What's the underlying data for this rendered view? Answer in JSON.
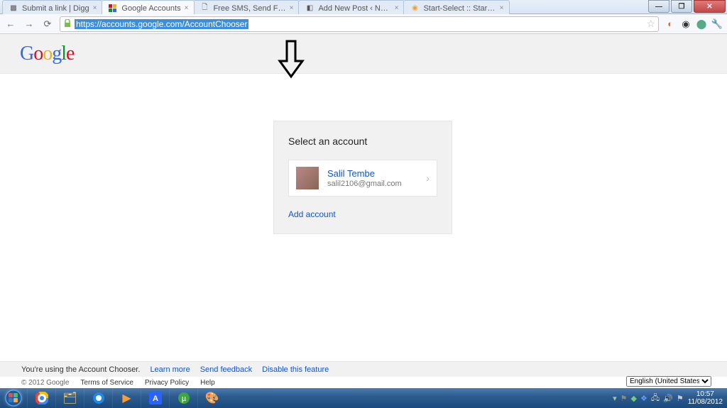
{
  "window": {
    "tabs": [
      {
        "title": "Submit a link | Digg",
        "active": false
      },
      {
        "title": "Google Accounts",
        "active": true
      },
      {
        "title": "Free SMS, Send Free SMS, S",
        "active": false
      },
      {
        "title": "Add New Post ‹ Nuclearrar",
        "active": false
      },
      {
        "title": "Start-Select :: Start/Select",
        "active": false
      }
    ],
    "url": "https://accounts.google.com/AccountChooser"
  },
  "page": {
    "logo": "Google",
    "card_title": "Select an account",
    "account": {
      "name": "Salil Tembe",
      "email": "salil2106@gmail.com"
    },
    "add_account": "Add account"
  },
  "footer": {
    "chooser_text": "You're using the Account Chooser.",
    "learn": "Learn more",
    "feedback": "Send feedback",
    "disable": "Disable this feature",
    "copyright": "© 2012 Google",
    "tos": "Terms of Service",
    "privacy": "Privacy Policy",
    "help": "Help",
    "language": "English (United States)"
  },
  "taskbar": {
    "time": "10:57",
    "date": "11/08/2012"
  }
}
